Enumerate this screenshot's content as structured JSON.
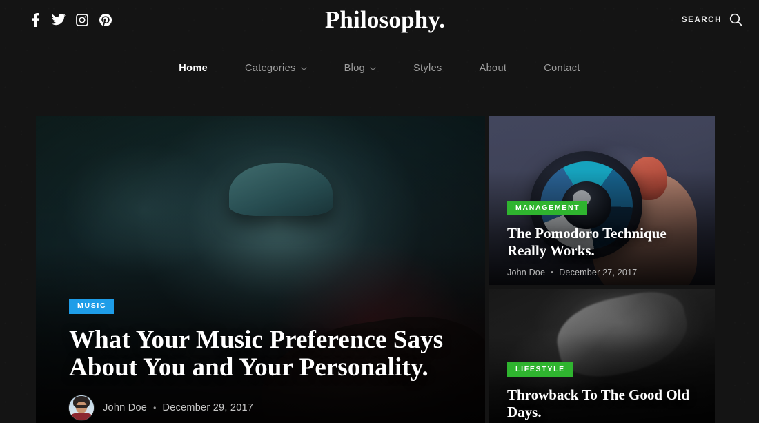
{
  "site": {
    "brand": "Philosophy.",
    "accent_blue": "#1e9de8",
    "accent_green": "#2fb42f",
    "background": "#141414"
  },
  "header": {
    "social": [
      {
        "name": "facebook-icon",
        "label": "Facebook"
      },
      {
        "name": "twitter-icon",
        "label": "Twitter"
      },
      {
        "name": "instagram-icon",
        "label": "Instagram"
      },
      {
        "name": "pinterest-icon",
        "label": "Pinterest"
      }
    ],
    "search": {
      "label": "SEARCH",
      "icon": "search-icon"
    }
  },
  "nav": {
    "items": [
      {
        "label": "Home",
        "active": true,
        "has_dropdown": false
      },
      {
        "label": "Categories",
        "active": false,
        "has_dropdown": true
      },
      {
        "label": "Blog",
        "active": false,
        "has_dropdown": true
      },
      {
        "label": "Styles",
        "active": false,
        "has_dropdown": false
      },
      {
        "label": "About",
        "active": false,
        "has_dropdown": false
      },
      {
        "label": "Contact",
        "active": false,
        "has_dropdown": false
      }
    ]
  },
  "featured": {
    "hero": {
      "category": "MUSIC",
      "category_color": "#1e9de8",
      "title": "What Your Music Preference Says About You and Your Personality.",
      "author": "John Doe",
      "separator": "•",
      "date": "December 29, 2017",
      "image_alt": "musician-in-hat-playing-guitar-photo"
    },
    "side_cards": [
      {
        "category": "MANAGEMENT",
        "category_color": "#2fb42f",
        "title": "The Pomodoro Technique Really Works.",
        "author": "John Doe",
        "separator": "•",
        "date": "December 27, 2017",
        "image_alt": "hand-holding-smartwatch-photo"
      },
      {
        "category": "LIFESTYLE",
        "category_color": "#2fb42f",
        "title": "Throwback To The Good Old Days.",
        "author": "",
        "separator": "",
        "date": "",
        "image_alt": "black-and-white-vintage-photo"
      }
    ]
  }
}
